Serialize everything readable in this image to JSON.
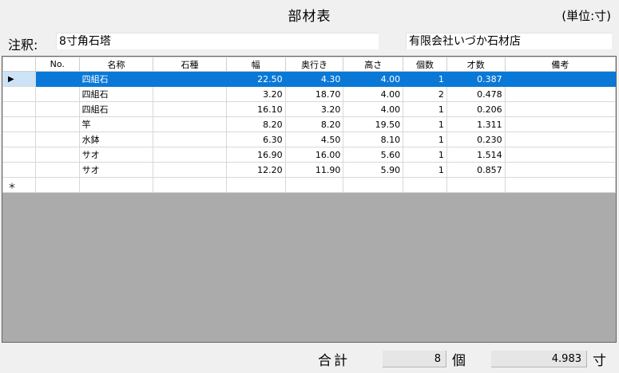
{
  "title": "部材表",
  "unit_label": "(単位:寸)",
  "note": {
    "label": "注釈:",
    "value": "8寸角石塔"
  },
  "shop_name": "有限会社いづか石材店",
  "columns": [
    "No.",
    "名称",
    "石種",
    "幅",
    "奥行き",
    "高さ",
    "個数",
    "才数",
    "備考"
  ],
  "rows": [
    {
      "no": "",
      "name": "四組石",
      "stone": "",
      "width": "22.50",
      "depth": "4.30",
      "height": "4.00",
      "count": "1",
      "sai": "0.387",
      "note": ""
    },
    {
      "no": "",
      "name": "四組石",
      "stone": "",
      "width": "3.20",
      "depth": "18.70",
      "height": "4.00",
      "count": "2",
      "sai": "0.478",
      "note": ""
    },
    {
      "no": "",
      "name": "四組石",
      "stone": "",
      "width": "16.10",
      "depth": "3.20",
      "height": "4.00",
      "count": "1",
      "sai": "0.206",
      "note": ""
    },
    {
      "no": "",
      "name": "竿",
      "stone": "",
      "width": "8.20",
      "depth": "8.20",
      "height": "19.50",
      "count": "1",
      "sai": "1.311",
      "note": ""
    },
    {
      "no": "",
      "name": "水鉢",
      "stone": "",
      "width": "6.30",
      "depth": "4.50",
      "height": "8.10",
      "count": "1",
      "sai": "0.230",
      "note": ""
    },
    {
      "no": "",
      "name": "サオ",
      "stone": "",
      "width": "16.90",
      "depth": "16.00",
      "height": "5.60",
      "count": "1",
      "sai": "1.514",
      "note": ""
    },
    {
      "no": "",
      "name": "サオ",
      "stone": "",
      "width": "12.20",
      "depth": "11.90",
      "height": "5.90",
      "count": "1",
      "sai": "0.857",
      "note": ""
    }
  ],
  "selected_row_marker": "▶",
  "new_row_marker": "＊",
  "footer": {
    "total_label": "合計",
    "total_count": "8",
    "count_unit": "個",
    "total_sai": "4.983",
    "sai_unit": "寸"
  },
  "colors": {
    "selection": "#0a78d7",
    "empty_grid": "#ababab"
  }
}
